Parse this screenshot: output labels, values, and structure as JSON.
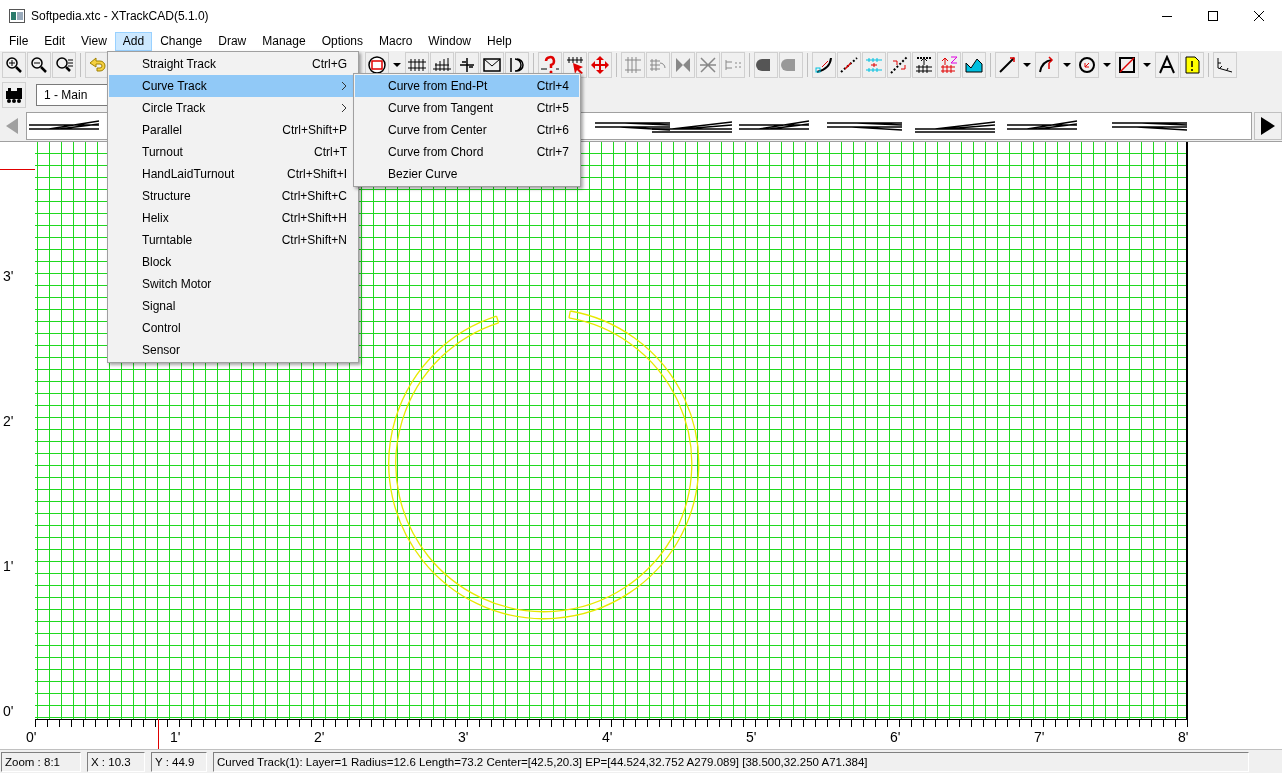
{
  "window": {
    "title": "Softpedia.xtc - XTrackCAD(5.1.0)"
  },
  "menu_bar": [
    {
      "label": "File",
      "selected": false
    },
    {
      "label": "Edit",
      "selected": false
    },
    {
      "label": "View",
      "selected": false
    },
    {
      "label": "Add",
      "selected": true
    },
    {
      "label": "Change",
      "selected": false
    },
    {
      "label": "Draw",
      "selected": false
    },
    {
      "label": "Manage",
      "selected": false
    },
    {
      "label": "Options",
      "selected": false
    },
    {
      "label": "Macro",
      "selected": false
    },
    {
      "label": "Window",
      "selected": false
    },
    {
      "label": "Help",
      "selected": false
    }
  ],
  "layer_field": {
    "value": "1 - Main"
  },
  "add_menu": [
    {
      "label": "Straight Track",
      "shortcut": "Ctrl+G",
      "submenu": false,
      "selected": false
    },
    {
      "label": "Curve Track",
      "submenu": true,
      "selected": true
    },
    {
      "label": "Circle Track",
      "submenu": true,
      "selected": false
    },
    {
      "label": "Parallel",
      "shortcut": "Ctrl+Shift+P",
      "submenu": false,
      "selected": false
    },
    {
      "label": "Turnout",
      "shortcut": "Ctrl+T",
      "submenu": false,
      "selected": false
    },
    {
      "label": "HandLaidTurnout",
      "shortcut": "Ctrl+Shift+I",
      "submenu": false,
      "selected": false
    },
    {
      "label": "Structure",
      "shortcut": "Ctrl+Shift+C",
      "submenu": false,
      "selected": false
    },
    {
      "label": "Helix",
      "shortcut": "Ctrl+Shift+H",
      "submenu": false,
      "selected": false
    },
    {
      "label": "Turntable",
      "shortcut": "Ctrl+Shift+N",
      "submenu": false,
      "selected": false
    },
    {
      "label": "Block",
      "submenu": false,
      "selected": false
    },
    {
      "label": "Switch Motor",
      "submenu": false,
      "selected": false
    },
    {
      "label": "Signal",
      "submenu": false,
      "selected": false
    },
    {
      "label": "Control",
      "submenu": false,
      "selected": false
    },
    {
      "label": "Sensor",
      "submenu": false,
      "selected": false
    }
  ],
  "curve_submenu": [
    {
      "label": "Curve from End-Pt",
      "shortcut": "Ctrl+4",
      "selected": true
    },
    {
      "label": "Curve from Tangent",
      "shortcut": "Ctrl+5",
      "selected": false
    },
    {
      "label": "Curve from Center",
      "shortcut": "Ctrl+6",
      "selected": false
    },
    {
      "label": "Curve from Chord",
      "shortcut": "Ctrl+7",
      "selected": false
    },
    {
      "label": "Bezier Curve",
      "selected": false
    }
  ],
  "vertical_ruler": [
    "3'",
    "2'",
    "1'",
    "0'"
  ],
  "horizontal_ruler": [
    "0'",
    "1'",
    "2'",
    "3'",
    "4'",
    "5'",
    "6'",
    "7'",
    "8'"
  ],
  "status_bar": {
    "zoom": "Zoom : 8:1",
    "x": "X : 10.3",
    "y": "Y : 44.9",
    "message": "Curved Track(1): Layer=1 Radius=12.6 Length=73.2 Center=[42.5,20.3] EP=[44.524,32.752 A279.089] [38.500,32.250 A71.384]"
  }
}
